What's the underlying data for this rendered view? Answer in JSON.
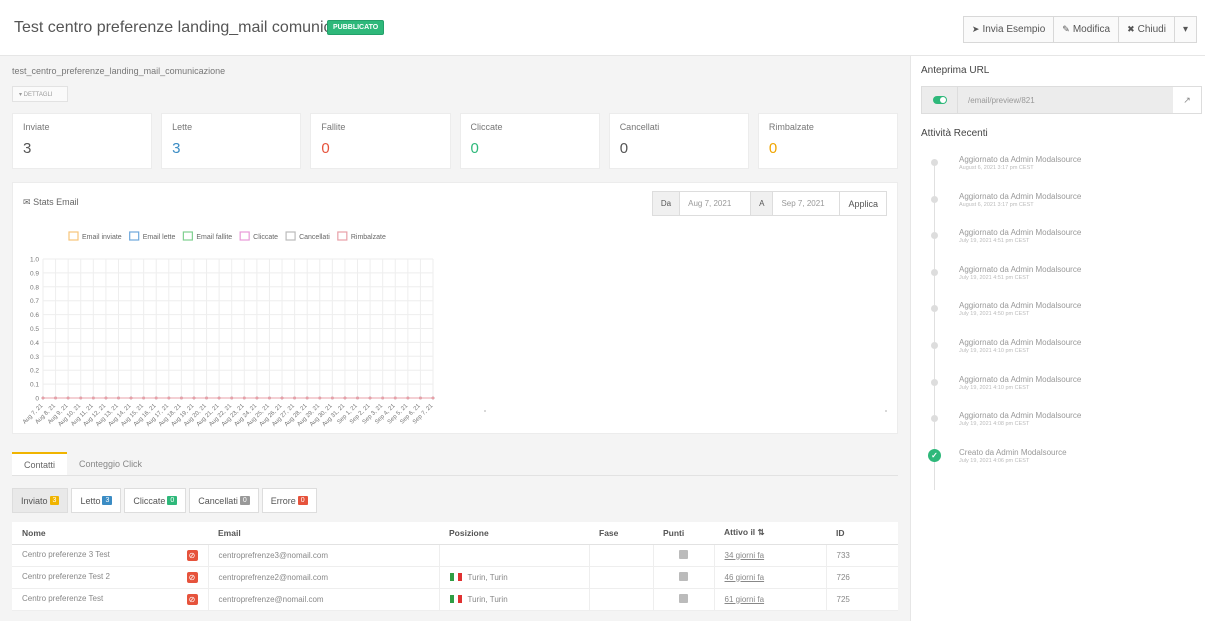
{
  "header": {
    "title": "Test centro preferenze landing_mail comunicazione",
    "status_badge": "PUBBLICATO",
    "buttons": {
      "send": "Invia Esempio",
      "edit": "Modifica",
      "close": "Chiudi"
    }
  },
  "main": {
    "slug": "test_centro_preferenze_landing_mail_comunicazione",
    "details_label": "▾ DETTAGLI",
    "stats": [
      {
        "label": "Inviate",
        "value": "3",
        "color": "#555555"
      },
      {
        "label": "Lette",
        "value": "3",
        "color": "#3b8cc4"
      },
      {
        "label": "Fallite",
        "value": "0",
        "color": "#e6533c"
      },
      {
        "label": "Cliccate",
        "value": "0",
        "color": "#2eb87a"
      },
      {
        "label": "Cancellati",
        "value": "0",
        "color": "#555555"
      },
      {
        "label": "Rimbalzate",
        "value": "0",
        "color": "#f0a500"
      }
    ],
    "chart_title": "Stats Email",
    "date_from_label": "Da",
    "date_from": "Aug 7, 2021",
    "date_to_label": "A",
    "date_to": "Sep 7, 2021",
    "apply_label": "Applica"
  },
  "chart_data": {
    "type": "line",
    "categories": [
      "Aug 7, 21",
      "Aug 8, 21",
      "Aug 9, 21",
      "Aug 10, 21",
      "Aug 11, 21",
      "Aug 12, 21",
      "Aug 13, 21",
      "Aug 14, 21",
      "Aug 15, 21",
      "Aug 16, 21",
      "Aug 17, 21",
      "Aug 18, 21",
      "Aug 19, 21",
      "Aug 20, 21",
      "Aug 21, 21",
      "Aug 22, 21",
      "Aug 23, 21",
      "Aug 24, 21",
      "Aug 25, 21",
      "Aug 26, 21",
      "Aug 27, 21",
      "Aug 28, 21",
      "Aug 29, 21",
      "Aug 30, 21",
      "Aug 31, 21",
      "Sep 1, 21",
      "Sep 2, 21",
      "Sep 3, 21",
      "Sep 4, 21",
      "Sep 5, 21",
      "Sep 6, 21",
      "Sep 7, 21"
    ],
    "series": [
      {
        "name": "Email inviate",
        "color": "#f7c57a",
        "values": [
          0,
          0,
          0,
          0,
          0,
          0,
          0,
          0,
          0,
          0,
          0,
          0,
          0,
          0,
          0,
          0,
          0,
          0,
          0,
          0,
          0,
          0,
          0,
          0,
          0,
          0,
          0,
          0,
          0,
          0,
          0,
          0
        ]
      },
      {
        "name": "Email lette",
        "color": "#6ea8dc",
        "values": [
          0,
          0,
          0,
          0,
          0,
          0,
          0,
          0,
          0,
          0,
          0,
          0,
          0,
          0,
          0,
          0,
          0,
          0,
          0,
          0,
          0,
          0,
          0,
          0,
          0,
          0,
          0,
          0,
          0,
          0,
          0,
          0
        ]
      },
      {
        "name": "Email fallite",
        "color": "#7fd08f",
        "values": [
          0,
          0,
          0,
          0,
          0,
          0,
          0,
          0,
          0,
          0,
          0,
          0,
          0,
          0,
          0,
          0,
          0,
          0,
          0,
          0,
          0,
          0,
          0,
          0,
          0,
          0,
          0,
          0,
          0,
          0,
          0,
          0
        ]
      },
      {
        "name": "Cliccate",
        "color": "#e89ad8",
        "values": [
          0,
          0,
          0,
          0,
          0,
          0,
          0,
          0,
          0,
          0,
          0,
          0,
          0,
          0,
          0,
          0,
          0,
          0,
          0,
          0,
          0,
          0,
          0,
          0,
          0,
          0,
          0,
          0,
          0,
          0,
          0,
          0
        ]
      },
      {
        "name": "Cancellati",
        "color": "#bbbbbb",
        "values": [
          0,
          0,
          0,
          0,
          0,
          0,
          0,
          0,
          0,
          0,
          0,
          0,
          0,
          0,
          0,
          0,
          0,
          0,
          0,
          0,
          0,
          0,
          0,
          0,
          0,
          0,
          0,
          0,
          0,
          0,
          0,
          0
        ]
      },
      {
        "name": "Rimbalzate",
        "color": "#e8a0a8",
        "values": [
          0,
          0,
          0,
          0,
          0,
          0,
          0,
          0,
          0,
          0,
          0,
          0,
          0,
          0,
          0,
          0,
          0,
          0,
          0,
          0,
          0,
          0,
          0,
          0,
          0,
          0,
          0,
          0,
          0,
          0,
          0,
          0
        ]
      }
    ],
    "y_ticks": [
      "1.0",
      "0.9",
      "0.8",
      "0.7",
      "0.6",
      "0.5",
      "0.4",
      "0.3",
      "0.2",
      "0.1",
      "0"
    ],
    "ylim": [
      0,
      1
    ],
    "grid": true,
    "legend_position": "top"
  },
  "tabs": [
    "Contatti",
    "Conteggio Click"
  ],
  "filters": [
    {
      "label": "Inviato",
      "count": "3",
      "color": "#f0b400",
      "active": true
    },
    {
      "label": "Letto",
      "count": "3",
      "color": "#3b8cc4",
      "active": false
    },
    {
      "label": "Cliccate",
      "count": "0",
      "color": "#2eb87a",
      "active": false
    },
    {
      "label": "Cancellati",
      "count": "0",
      "color": "#999999",
      "active": false
    },
    {
      "label": "Errore",
      "count": "0",
      "color": "#e6533c",
      "active": false
    }
  ],
  "table": {
    "headers": [
      "Nome",
      "Email",
      "Posizione",
      "Fase",
      "Punti",
      "Attivo il",
      "ID"
    ],
    "rows": [
      {
        "name": "Centro preferenze 3 Test",
        "email": "centroprefrenze3@nomail.com",
        "location": "",
        "phase": "",
        "active": "34 giorni fa",
        "id": "733"
      },
      {
        "name": "Centro preferenze Test 2",
        "email": "centroprefrenze2@nomail.com",
        "location": "Turin, Turin",
        "phase": "",
        "active": "46 giorni fa",
        "id": "726"
      },
      {
        "name": "Centro preferenze Test",
        "email": "centroprefrenze@nomail.com",
        "location": "Turin, Turin",
        "phase": "",
        "active": "61 giorni fa",
        "id": "725"
      }
    ]
  },
  "right": {
    "preview_title": "Anteprima URL",
    "preview_url": "/email/preview/821",
    "activity_title": "Attività Recenti",
    "activities": [
      {
        "text": "Aggiornato da Admin Modalsource",
        "date": "August 6, 2021 3:17 pm CEST"
      },
      {
        "text": "Aggiornato da Admin Modalsource",
        "date": "August 6, 2021 3:17 pm CEST"
      },
      {
        "text": "Aggiornato da Admin Modalsource",
        "date": "July 19, 2021 4:51 pm CEST"
      },
      {
        "text": "Aggiornato da Admin Modalsource",
        "date": "July 19, 2021 4:51 pm CEST"
      },
      {
        "text": "Aggiornato da Admin Modalsource",
        "date": "July 19, 2021 4:50 pm CEST"
      },
      {
        "text": "Aggiornato da Admin Modalsource",
        "date": "July 19, 2021 4:10 pm CEST"
      },
      {
        "text": "Aggiornato da Admin Modalsource",
        "date": "July 19, 2021 4:10 pm CEST"
      },
      {
        "text": "Aggiornato da Admin Modalsource",
        "date": "July 19, 2021 4:08 pm CEST"
      },
      {
        "text": "Creato da Admin Modalsource",
        "date": "July 19, 2021 4:06 pm CEST"
      }
    ]
  }
}
